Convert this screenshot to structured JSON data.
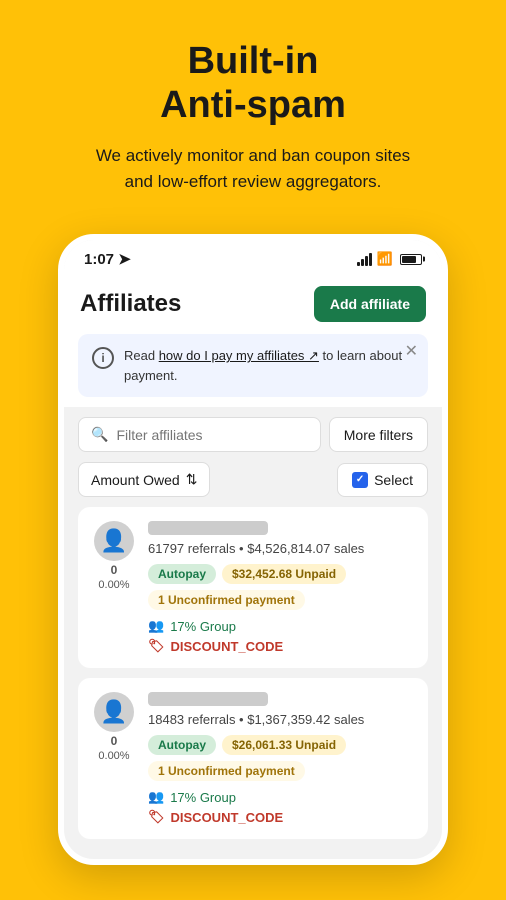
{
  "hero": {
    "title": "Built-in\nAnti-spam",
    "subtitle": "We actively monitor and ban coupon sites\nand low-effort review aggregators."
  },
  "phone": {
    "status_bar": {
      "time": "1:07",
      "signal": "signal",
      "wifi": "wifi",
      "battery": "battery"
    },
    "header": {
      "title": "Affiliates",
      "add_button": "Add affiliate"
    },
    "info_banner": {
      "text": "Read ",
      "link": "how do I pay my affiliates",
      "text2": " to learn about payment."
    },
    "search": {
      "placeholder": "Filter affiliates",
      "more_filters": "More filters"
    },
    "sort": {
      "amount_owed": "Amount Owed",
      "select": "Select"
    },
    "affiliates": [
      {
        "id": 1,
        "count": "0",
        "percent": "0.00%",
        "stats": "61797 referrals • $4,526,814.07 sales",
        "tags": [
          "Autopay",
          "$32,452.68 Unpaid",
          "1 Unconfirmed payment"
        ],
        "group": "17% Group",
        "code": "DISCOUNT_CODE"
      },
      {
        "id": 2,
        "count": "0",
        "percent": "0.00%",
        "stats": "18483 referrals • $1,367,359.42 sales",
        "tags": [
          "Autopay",
          "$26,061.33 Unpaid",
          "1 Unconfirmed payment"
        ],
        "group": "17% Group",
        "code": "DISCOUNT_CODE"
      }
    ]
  }
}
